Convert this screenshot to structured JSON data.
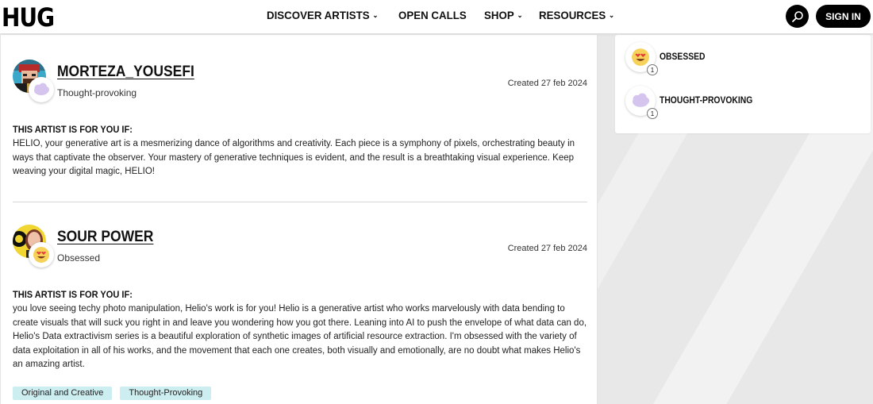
{
  "header": {
    "logo": "HUG",
    "nav": [
      {
        "label": "DISCOVER ARTISTS",
        "has_dropdown": true
      },
      {
        "label": "OPEN CALLS",
        "has_dropdown": false
      },
      {
        "label": "SHOP",
        "has_dropdown": true
      },
      {
        "label": "RESOURCES",
        "has_dropdown": true
      }
    ],
    "search_icon": "search-icon",
    "sign_in": "SIGN IN"
  },
  "reviews": [
    {
      "name": "MORTEZA_YOUSEFI",
      "reaction": "Thought-provoking",
      "reaction_icon": "cloud-icon",
      "created": "Created 27 feb 2024",
      "heading": "THIS ARTIST IS FOR YOU IF:",
      "body": "HELIO, your generative art is a mesmerizing dance of algorithms and creativity. Each piece is a symphony of pixels, orchestrating beauty in ways that captivate the observer. Your mastery of generative techniques is evident, and the result is a breathtaking visual experience. Keep weaving your digital magic, HELIO!"
    },
    {
      "name": "SOUR POWER",
      "reaction": "Obsessed",
      "reaction_icon": "heart-eyes-emoji-icon",
      "created": "Created 27 feb 2024",
      "heading": "THIS ARTIST IS FOR YOU IF:",
      "body": "you love seeing techy photo manipulation, Helio's work is for you! Helio is a generative artist who works marvelously with data bending to create visuals that will suck you right in and leave you wondering how you got there. Leaning into AI to push the envelope of what data can do, Helio's Data extractivism series is a beautiful exploration of synthetic images of artificial resource extraction. I'm obsessed with the variety of data exploitation in all of his works, and the movement that each one creates, both visually and emotionally, are no doubt what makes Helio's an amazing artist.",
      "tags": [
        "Original and Creative",
        "Thought-Provoking"
      ]
    }
  ],
  "reactions_summary": [
    {
      "label": "OBSESSED",
      "count": "1",
      "icon": "heart-eyes-emoji-icon"
    },
    {
      "label": "THOUGHT-PROVOKING",
      "count": "1",
      "icon": "cloud-icon"
    }
  ],
  "colors": {
    "tag_bg": "#cdeef0",
    "cloud": "#d4c4ee",
    "emoji_face": "#f6d25a"
  }
}
